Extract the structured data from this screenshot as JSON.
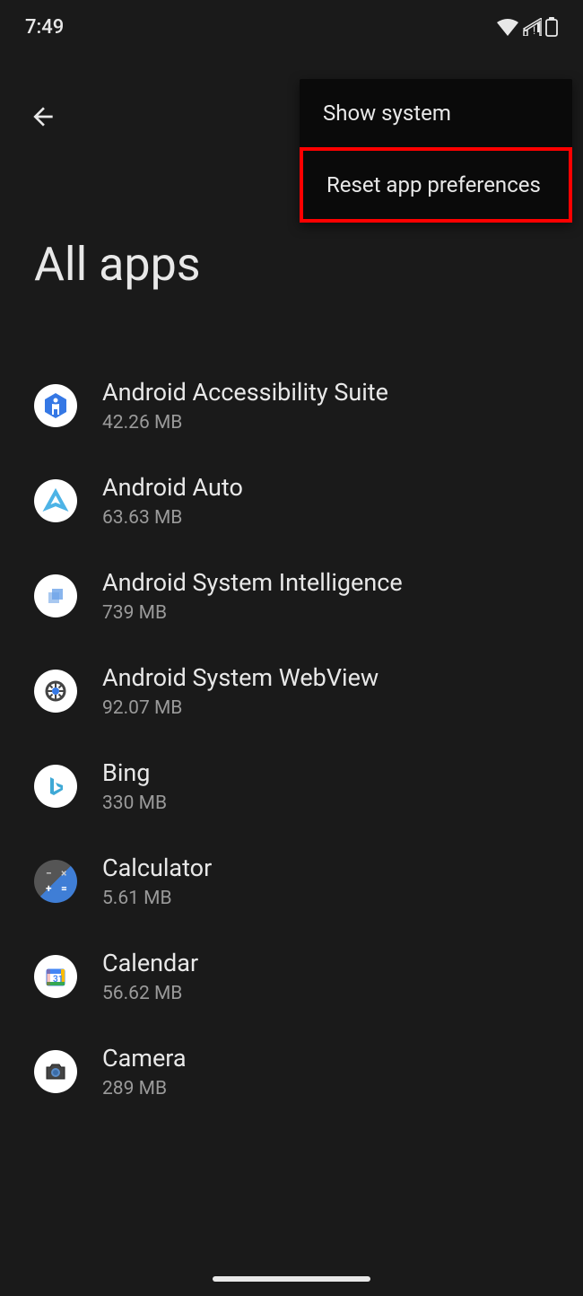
{
  "statusBar": {
    "time": "7:49"
  },
  "menu": {
    "showSystem": "Show system",
    "resetAppPreferences": "Reset app preferences"
  },
  "pageTitle": "All apps",
  "apps": [
    {
      "name": "Android Accessibility Suite",
      "size": "42.26 MB",
      "iconId": "accessibility"
    },
    {
      "name": "Android Auto",
      "size": "63.63 MB",
      "iconId": "auto"
    },
    {
      "name": "Android System Intelligence",
      "size": "739 MB",
      "iconId": "intelligence"
    },
    {
      "name": "Android System WebView",
      "size": "92.07 MB",
      "iconId": "webview"
    },
    {
      "name": "Bing",
      "size": "330 MB",
      "iconId": "bing"
    },
    {
      "name": "Calculator",
      "size": "5.61 MB",
      "iconId": "calculator"
    },
    {
      "name": "Calendar",
      "size": "56.62 MB",
      "iconId": "calendar"
    },
    {
      "name": "Camera",
      "size": "289 MB",
      "iconId": "camera"
    }
  ]
}
